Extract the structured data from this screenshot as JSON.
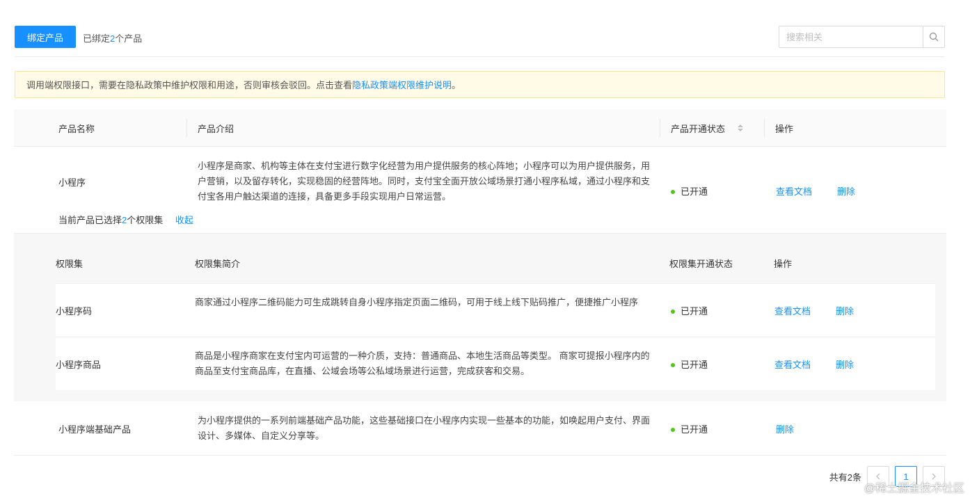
{
  "toolbar": {
    "bind_button": "绑定产品",
    "bound_prefix": "已绑定",
    "bound_count": "2",
    "bound_suffix": "个产品",
    "search_placeholder": "搜索相关"
  },
  "alert": {
    "text": "调用端权限接口，需要在隐私政策中维护权限和用途，否则审核会驳回。点击查看",
    "link": "隐私政策端权限维护说明",
    "end": "。"
  },
  "table": {
    "headers": {
      "name": "产品名称",
      "intro": "产品介绍",
      "status": "产品开通状态",
      "action": "操作"
    },
    "rows": [
      {
        "name": "小程序",
        "intro": "小程序是商家、机构等主体在支付宝进行数字化经营为用户提供服务的核心阵地；小程序可以为用户提供服务，用户营销，以及留存转化，实现稳固的经营阵地。同时，支付宝全面开放公域场景打通小程序私域，通过小程序和支付宝各用户触达渠道的连接，具备更多手段实现用户日常运营。",
        "status": "已开通",
        "doc": "查看文档",
        "delete": "删除",
        "selected_prefix": "当前产品已选择",
        "selected_count": "2",
        "selected_suffix": "个权限集",
        "collapse": "收起"
      },
      {
        "name": "小程序端基础产品",
        "intro": "为小程序提供的一系列前端基础产品功能，这些基础接口在小程序内实现一些基本的功能，如唤起用户支付、界面设计、多媒体、自定义分享等。",
        "status": "已开通",
        "delete": "删除"
      }
    ]
  },
  "permissions": {
    "headers": {
      "name": "权限集",
      "intro": "权限集简介",
      "status": "权限集开通状态",
      "action": "操作"
    },
    "rows": [
      {
        "name": "小程序码",
        "intro": "商家通过小程序二维码能力可生成跳转自身小程序指定页面二维码，可用于线上线下贴码推广，便捷推广小程序",
        "status": "已开通",
        "doc": "查看文档",
        "delete": "删除"
      },
      {
        "name": "小程序商品",
        "intro": "商品是小程序商家在支付宝内可运营的一种介质，支持：普通商品、本地生活商品等类型。 商家可提报小程序内的商品至支付宝商品库，在直播、公域会场等公私域场景进行运营，完成获客和交易。",
        "status": "已开通",
        "doc": "查看文档",
        "delete": "删除"
      }
    ]
  },
  "pagination": {
    "total": "共有2条",
    "current": "1"
  },
  "watermark": "@稀土掘金技术社区",
  "colors": {
    "primary": "#1890ff",
    "success": "#52c41a",
    "alert_bg": "#fffbe6",
    "alert_border": "#ffe58f"
  }
}
